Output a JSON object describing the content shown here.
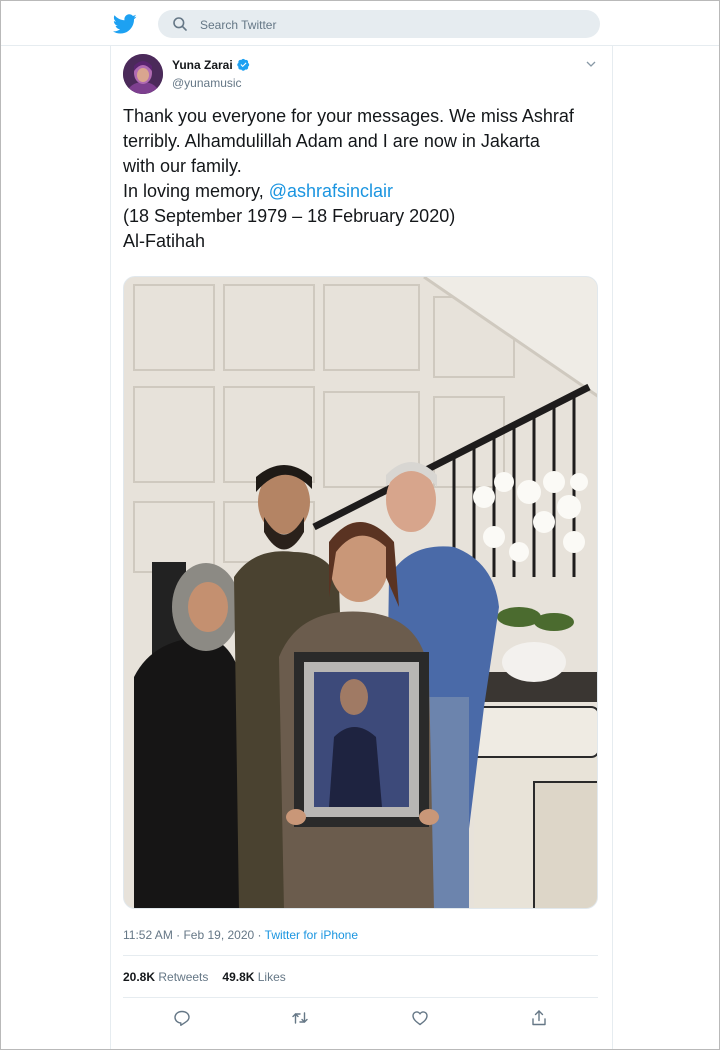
{
  "header": {
    "search_placeholder": "Search Twitter"
  },
  "tweet": {
    "author": {
      "name": "Yuna Zarai",
      "handle": "@yunamusic",
      "verified": true
    },
    "text_lines": [
      "Thank you everyone for your messages. We miss Ashraf",
      "terribly. Alhamdulillah Adam and I are now in Jakarta",
      "with our family.",
      "In loving memory, "
    ],
    "mention": "@ashrafsinclair",
    "text_lines_after": [
      "(18 September 1979 – 18 February 2020)",
      "Al-Fatihah"
    ],
    "time": "11:52 AM · Feb 19, 2020 · ",
    "source": "Twitter for iPhone",
    "stats": {
      "retweets_count": "20.8K",
      "retweets_label": " Retweets",
      "likes_count": "49.8K",
      "likes_label": " Likes"
    }
  },
  "icons": {
    "logo": "twitter-bird-icon",
    "search": "search-icon",
    "verified": "verified-badge-icon",
    "menu": "chevron-down-icon",
    "reply": "reply-icon",
    "retweet": "retweet-icon",
    "like": "heart-icon",
    "share": "share-icon"
  },
  "colors": {
    "brand": "#1da1f2",
    "link": "#1b95e0",
    "secondary_text": "#657786",
    "search_bg": "#e6ecf0"
  }
}
